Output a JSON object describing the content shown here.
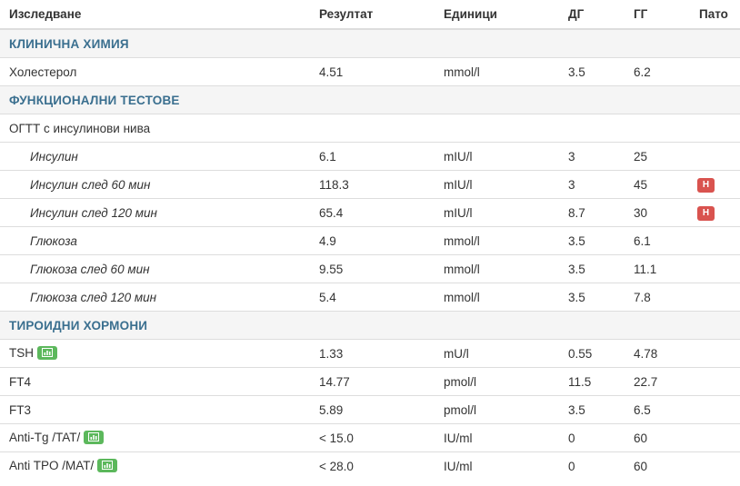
{
  "headers": {
    "test": "Изследване",
    "result": "Резултат",
    "units": "Единици",
    "low": "ДГ",
    "high": "ГГ",
    "patho": "Пато"
  },
  "sections": {
    "clinical": "КЛИНИЧНА ХИМИЯ",
    "functional": "ФУНКЦИОНАЛНИ ТЕСТОВЕ",
    "thyroid": "ТИРОИДНИ ХОРМОНИ"
  },
  "rows": {
    "cholesterol": {
      "name": "Холестерол",
      "result": "4.51",
      "units": "mmol/l",
      "low": "3.5",
      "high": "6.2"
    },
    "ogtt": {
      "name": "ОГТТ с инсулинови нива"
    },
    "insulin": {
      "name": "Инсулин",
      "result": "6.1",
      "units": "mIU/l",
      "low": "3",
      "high": "25"
    },
    "insulin60": {
      "name": "Инсулин след 60 мин",
      "result": "118.3",
      "units": "mIU/l",
      "low": "3",
      "high": "45",
      "flag": "Н"
    },
    "insulin120": {
      "name": "Инсулин след 120 мин",
      "result": "65.4",
      "units": "mIU/l",
      "low": "8.7",
      "high": "30",
      "flag": "Н"
    },
    "glucose": {
      "name": "Глюкоза",
      "result": "4.9",
      "units": "mmol/l",
      "low": "3.5",
      "high": "6.1"
    },
    "glucose60": {
      "name": "Глюкоза след 60 мин",
      "result": "9.55",
      "units": "mmol/l",
      "low": "3.5",
      "high": "11.1"
    },
    "glucose120": {
      "name": "Глюкоза след 120 мин",
      "result": "5.4",
      "units": "mmol/l",
      "low": "3.5",
      "high": "7.8"
    },
    "tsh": {
      "name": "TSH",
      "result": "1.33",
      "units": "mU/l",
      "low": "0.55",
      "high": "4.78"
    },
    "ft4": {
      "name": "FT4",
      "result": "14.77",
      "units": "pmol/l",
      "low": "11.5",
      "high": "22.7"
    },
    "ft3": {
      "name": "FT3",
      "result": "5.89",
      "units": "pmol/l",
      "low": "3.5",
      "high": "6.5"
    },
    "antitg": {
      "name": "Anti-Tg /TAT/",
      "result": "< 15.0",
      "units": "IU/ml",
      "low": "0",
      "high": "60"
    },
    "antitpo": {
      "name": "Anti TPO /MAT/",
      "result": "< 28.0",
      "units": "IU/ml",
      "low": "0",
      "high": "60"
    }
  },
  "colors": {
    "section_text": "#3a6f8f",
    "flag_high": "#d9534f",
    "chart_button": "#5cb85c"
  },
  "icons": {
    "chart": "chart-icon"
  }
}
